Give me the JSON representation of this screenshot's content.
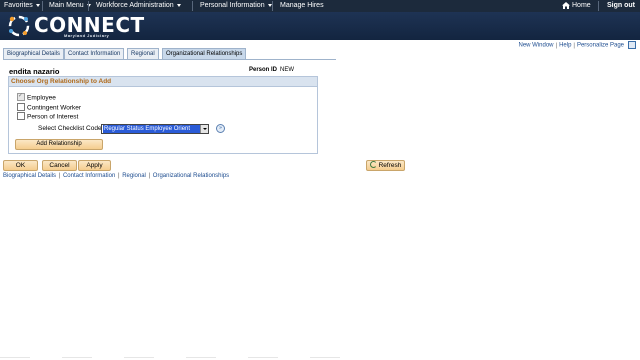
{
  "topnav": {
    "favorites": "Favorites",
    "main_menu": "Main Menu",
    "breadcrumbs": [
      "Workforce Administration",
      "Personal Information",
      "Manage Hires"
    ],
    "home": "Home",
    "signout": "Sign out"
  },
  "banner": {
    "title": "CONNECT",
    "subtitle": "Maryland Judiciary"
  },
  "utility_links": {
    "new_window": "New Window",
    "help": "Help",
    "personalize": "Personalize Page"
  },
  "tabs": [
    {
      "label": "Biographical Details",
      "active": false
    },
    {
      "label": "Contact Information",
      "active": false
    },
    {
      "label": "Regional",
      "active": false
    },
    {
      "label": "Organizational Relationships",
      "active": true
    }
  ],
  "person": {
    "name": "endita nazario",
    "id_label": "Person ID",
    "id_value": "NEW"
  },
  "org_box": {
    "title": "Choose Org Relationship to Add",
    "checkboxes": [
      {
        "label": "Employee",
        "checked": true,
        "disabled": true
      },
      {
        "label": "Contingent Worker",
        "checked": false,
        "disabled": false
      },
      {
        "label": "Person of Interest",
        "checked": false,
        "disabled": false
      }
    ],
    "checklist_label": "Select Checklist Code",
    "checklist_value": "Regular Status Employee Orient",
    "add_button": "Add Relationship"
  },
  "buttons": {
    "ok": "OK",
    "cancel": "Cancel",
    "apply": "Apply",
    "refresh": "Refresh"
  },
  "bottom_links": [
    "Biographical Details",
    "Contact Information",
    "Regional",
    "Organizational Relationships"
  ],
  "colors": {
    "nav_bg": "#1c2a3c",
    "banner_bg": "#1e3354",
    "section_title": "#b06a1a",
    "link": "#1d4c8f",
    "button": "#f5cd8e"
  }
}
